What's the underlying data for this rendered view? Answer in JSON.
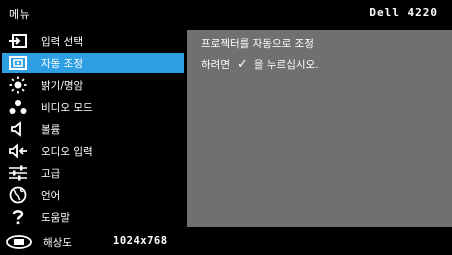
{
  "header": {
    "menu_title": "메뉴",
    "model": "Dell 4220"
  },
  "colors": {
    "accent": "#2f9fe3",
    "panel": "#707070",
    "background": "#000000"
  },
  "menu": {
    "items": [
      {
        "icon": "input-select-icon",
        "label": "입력 선택",
        "active": false
      },
      {
        "icon": "auto-adjust-icon",
        "label": "자동 조정",
        "active": true
      },
      {
        "icon": "brightness-icon",
        "label": "밝기/명암",
        "active": false
      },
      {
        "icon": "video-mode-icon",
        "label": "비디오 모드",
        "active": false
      },
      {
        "icon": "volume-icon",
        "label": "볼륨",
        "active": false
      },
      {
        "icon": "audio-input-icon",
        "label": "오디오 입력",
        "active": false
      },
      {
        "icon": "advanced-icon",
        "label": "고급",
        "active": false
      },
      {
        "icon": "language-icon",
        "label": "언어",
        "active": false
      },
      {
        "icon": "help-icon",
        "label": "도움말",
        "active": false
      }
    ]
  },
  "content": {
    "line1": "프로젝터를 자동으로 조정",
    "line2_prefix": "하려면",
    "check_glyph": "✓",
    "line2_suffix": "을 누르십시오."
  },
  "footer": {
    "resolution_label": "해상도",
    "resolution_value": "1024x768"
  }
}
